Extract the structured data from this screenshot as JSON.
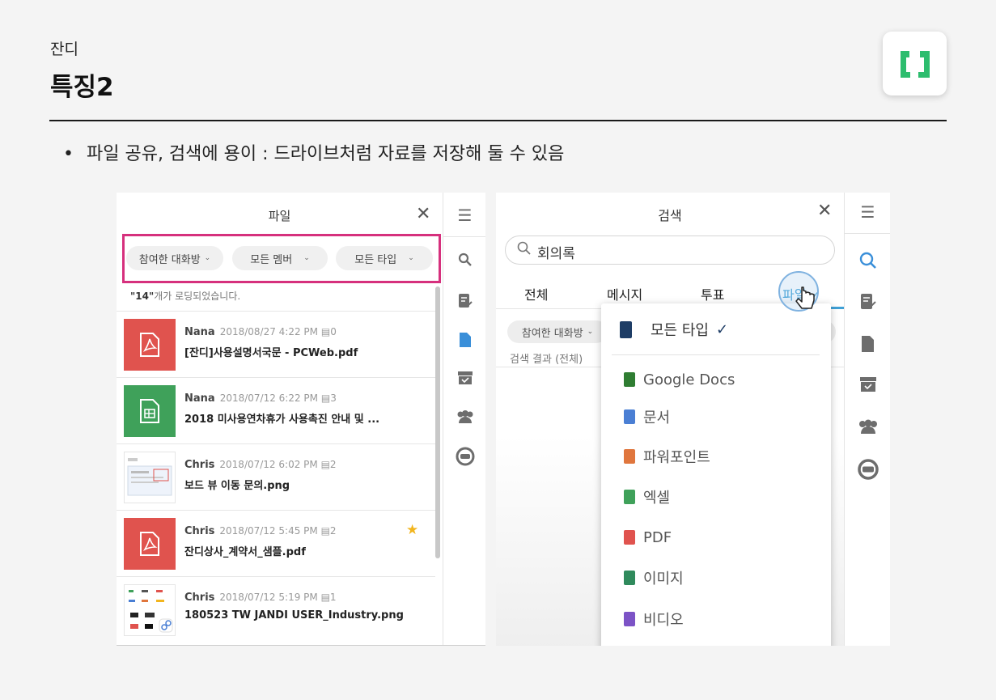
{
  "header": {
    "eyebrow": "잔디",
    "title": "특징2"
  },
  "bullet": "파일 공유, 검색에 용이 : 드라이브처럼 자료를 저장해 둘 수 있음",
  "left_panel": {
    "title": "파일",
    "close_icon": "close-icon",
    "filters": [
      "참여한 대화방",
      "모든 멤버",
      "모든 타입"
    ],
    "loaded_count": "\"14\"",
    "loaded_suffix": "개가 로딩되었습니다.",
    "files": [
      {
        "author": "Nana",
        "date": "2018/08/27 4:22 PM",
        "comments": "0",
        "name": "[잔디]사용설명서국문 - PCWeb.pdf",
        "type": "pdf",
        "starred": false
      },
      {
        "author": "Nana",
        "date": "2018/07/12 6:22 PM",
        "comments": "3",
        "name": "2018 미사용연차휴가 사용촉진 안내 및 ...",
        "type": "sheet",
        "starred": false
      },
      {
        "author": "Chris",
        "date": "2018/07/12 6:02 PM",
        "comments": "2",
        "name": "보드 뷰 이동 문의.png",
        "type": "image",
        "starred": false
      },
      {
        "author": "Chris",
        "date": "2018/07/12 5:45 PM",
        "comments": "2",
        "name": "잔디상사_계약서_샘플.pdf",
        "type": "pdf",
        "starred": true
      },
      {
        "author": "Chris",
        "date": "2018/07/12 5:19 PM",
        "comments": "1",
        "name": "180523 TW JANDI USER_Industry.png",
        "type": "image",
        "starred": false
      }
    ],
    "rail_icons": [
      "menu-icon",
      "search-icon",
      "todo-icon",
      "file-icon",
      "archive-icon",
      "members-icon",
      "connect-icon"
    ]
  },
  "right_panel": {
    "title": "검색",
    "search_query": "회의록",
    "tabs": [
      "전체",
      "메시지",
      "투표",
      "파일"
    ],
    "active_tab": "파일",
    "filter_chip": "참여한 대화방",
    "results_label": "검색 결과 (전체)",
    "dropdown": {
      "selected": "모든 타입",
      "items": [
        {
          "label": "Google Docs",
          "color": "#2f7d32"
        },
        {
          "label": "문서",
          "color": "#4a7fd4"
        },
        {
          "label": "파워포인트",
          "color": "#e0763d"
        },
        {
          "label": "엑셀",
          "color": "#3fa15a"
        },
        {
          "label": "PDF",
          "color": "#e0534e"
        },
        {
          "label": "이미지",
          "color": "#2f8a5c"
        },
        {
          "label": "비디오",
          "color": "#7c53c6"
        }
      ]
    },
    "rail_icons": [
      "menu-icon",
      "search-icon",
      "todo-icon",
      "file-icon",
      "archive-icon",
      "members-icon",
      "connect-icon"
    ]
  },
  "colors": {
    "accent": "#3fa0d6",
    "highlight_box": "#d6307d",
    "logo_green": "#2dbd6e"
  }
}
